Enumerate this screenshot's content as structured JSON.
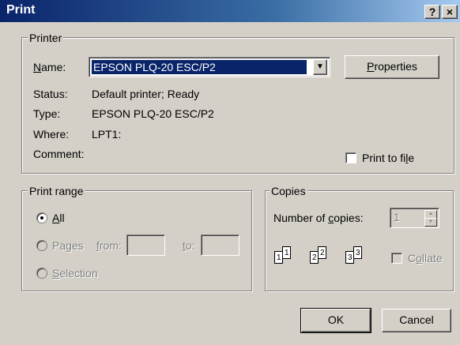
{
  "window": {
    "title": "Print",
    "help_label": "?",
    "close_label": "×"
  },
  "printer": {
    "group_label": "Printer",
    "name_label_prefix": "N",
    "name_label_rest": "ame:",
    "selected_printer": "EPSON PLQ-20 ESC/P2",
    "properties_prefix": "P",
    "properties_rest": "roperties",
    "status_label": "Status:",
    "status_value": "Default printer; Ready",
    "type_label": "Type:",
    "type_value": "EPSON PLQ-20 ESC/P2",
    "where_label": "Where:",
    "where_value": "LPT1:",
    "comment_label": "Comment:",
    "comment_value": "",
    "print_to_file_prefix": "Print to fi",
    "print_to_file_u": "l",
    "print_to_file_rest": "e",
    "print_to_file_checked": false
  },
  "print_range": {
    "group_label": "Print range",
    "all_prefix": "A",
    "all_rest": "ll",
    "pages_prefix": "Pa",
    "pages_u": "g",
    "pages_rest": "es",
    "from_u": "f",
    "from_rest": "rom:",
    "to_u": "t",
    "to_rest": "o:",
    "from_value": "",
    "to_value": "",
    "selection_prefix": "S",
    "selection_rest": "election",
    "selected": "All"
  },
  "copies": {
    "group_label": "Copies",
    "number_label_prefix": "Number of ",
    "number_label_u": "c",
    "number_label_rest": "opies:",
    "number_value": "1",
    "collate_prefix": "C",
    "collate_u": "o",
    "collate_rest": "llate",
    "collate_checked": false,
    "page_numbers": [
      "1",
      "1",
      "2",
      "2",
      "3",
      "3"
    ]
  },
  "buttons": {
    "ok": "OK",
    "cancel": "Cancel"
  },
  "colors": {
    "titlebar_start": "#0a246a",
    "titlebar_end": "#a6caf0",
    "face": "#d4d0c8",
    "selection": "#0a246a"
  }
}
